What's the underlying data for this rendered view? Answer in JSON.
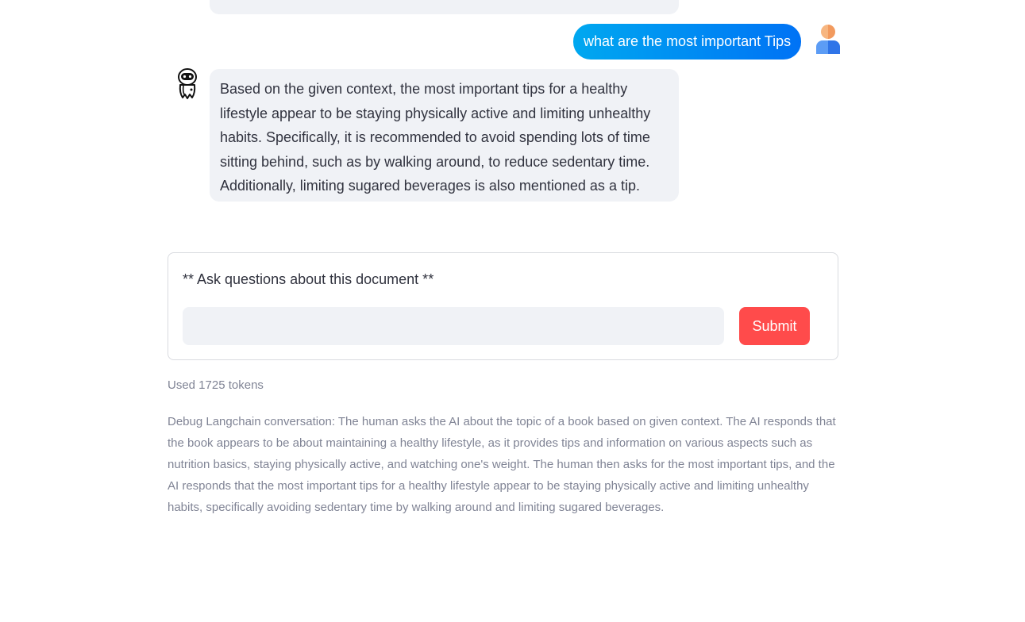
{
  "chat": {
    "user_message": "what are the most important Tips",
    "bot_message": "Based on the given context, the most important tips for a healthy lifestyle appear to be staying physically active and limiting unhealthy habits. Specifically, it is recommended to avoid spending lots of time sitting behind, such as by walking around, to reduce sedentary time. Additionally, limiting sugared beverages is also mentioned as a tip."
  },
  "form": {
    "label": "** Ask questions about this document **",
    "input_value": "",
    "submit_label": "Submit"
  },
  "tokens_text": "Used 1725 tokens",
  "debug_text": "Debug Langchain conversation: The human asks the AI about the topic of a book based on given context. The AI responds that the book appears to be about maintaining a healthy lifestyle, as it provides tips and information on various aspects such as nutrition basics, staying physically active, and watching one's weight. The human then asks for the most important tips, and the AI responds that the most important tips for a healthy lifestyle appear to be staying physically active and limiting unhealthy habits, specifically avoiding sedentary time by walking around and limiting sugared beverages.",
  "icons": {
    "user_avatar": "user-avatar-icon",
    "bot_avatar": "robot-icon"
  },
  "colors": {
    "user_bubble_start": "#00a8f0",
    "user_bubble_end": "#0072f5",
    "bot_bubble": "#f0f2f6",
    "submit": "#ff4b4b",
    "muted_text": "#808495"
  }
}
